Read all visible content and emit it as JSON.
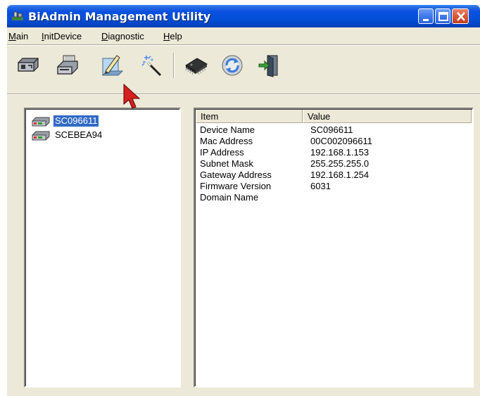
{
  "window": {
    "title": "BiAdmin Management Utility"
  },
  "menu": [
    {
      "label": "Main",
      "accel": "M",
      "rest": "ain"
    },
    {
      "label": "InitDevice",
      "accel": "I",
      "rest": "nitDevice"
    },
    {
      "label": "Diagnostic",
      "accel": "D",
      "rest": "iagnostic"
    },
    {
      "label": "Help",
      "accel": "H",
      "rest": "elp"
    }
  ],
  "toolbar": {
    "buttons": [
      {
        "name": "network-device-icon"
      },
      {
        "name": "card-reader-icon"
      },
      {
        "name": "edit-config-icon"
      },
      {
        "name": "magic-wand-icon"
      },
      {
        "name": "chip-icon"
      },
      {
        "name": "refresh-icon"
      },
      {
        "name": "exit-door-icon"
      }
    ]
  },
  "devices": [
    {
      "label": "SC096611",
      "selected": true
    },
    {
      "label": "SCEBEA94",
      "selected": false
    }
  ],
  "details": {
    "columns": [
      "Item",
      "Value"
    ],
    "rows": [
      {
        "item": "Device Name",
        "value": "SC096611"
      },
      {
        "item": "Mac Address",
        "value": "00C002096611"
      },
      {
        "item": "IP Address",
        "value": "192.168.1.153"
      },
      {
        "item": "Subnet Mask",
        "value": "255.255.255.0"
      },
      {
        "item": "Gateway Address",
        "value": "192.168.1.254"
      },
      {
        "item": "Firmware Version",
        "value": "6031"
      },
      {
        "item": "Domain Name",
        "value": ""
      }
    ]
  },
  "colors": {
    "titlebar": "#0350d8",
    "selection": "#316ac5",
    "window_face": "#ece9d8"
  }
}
